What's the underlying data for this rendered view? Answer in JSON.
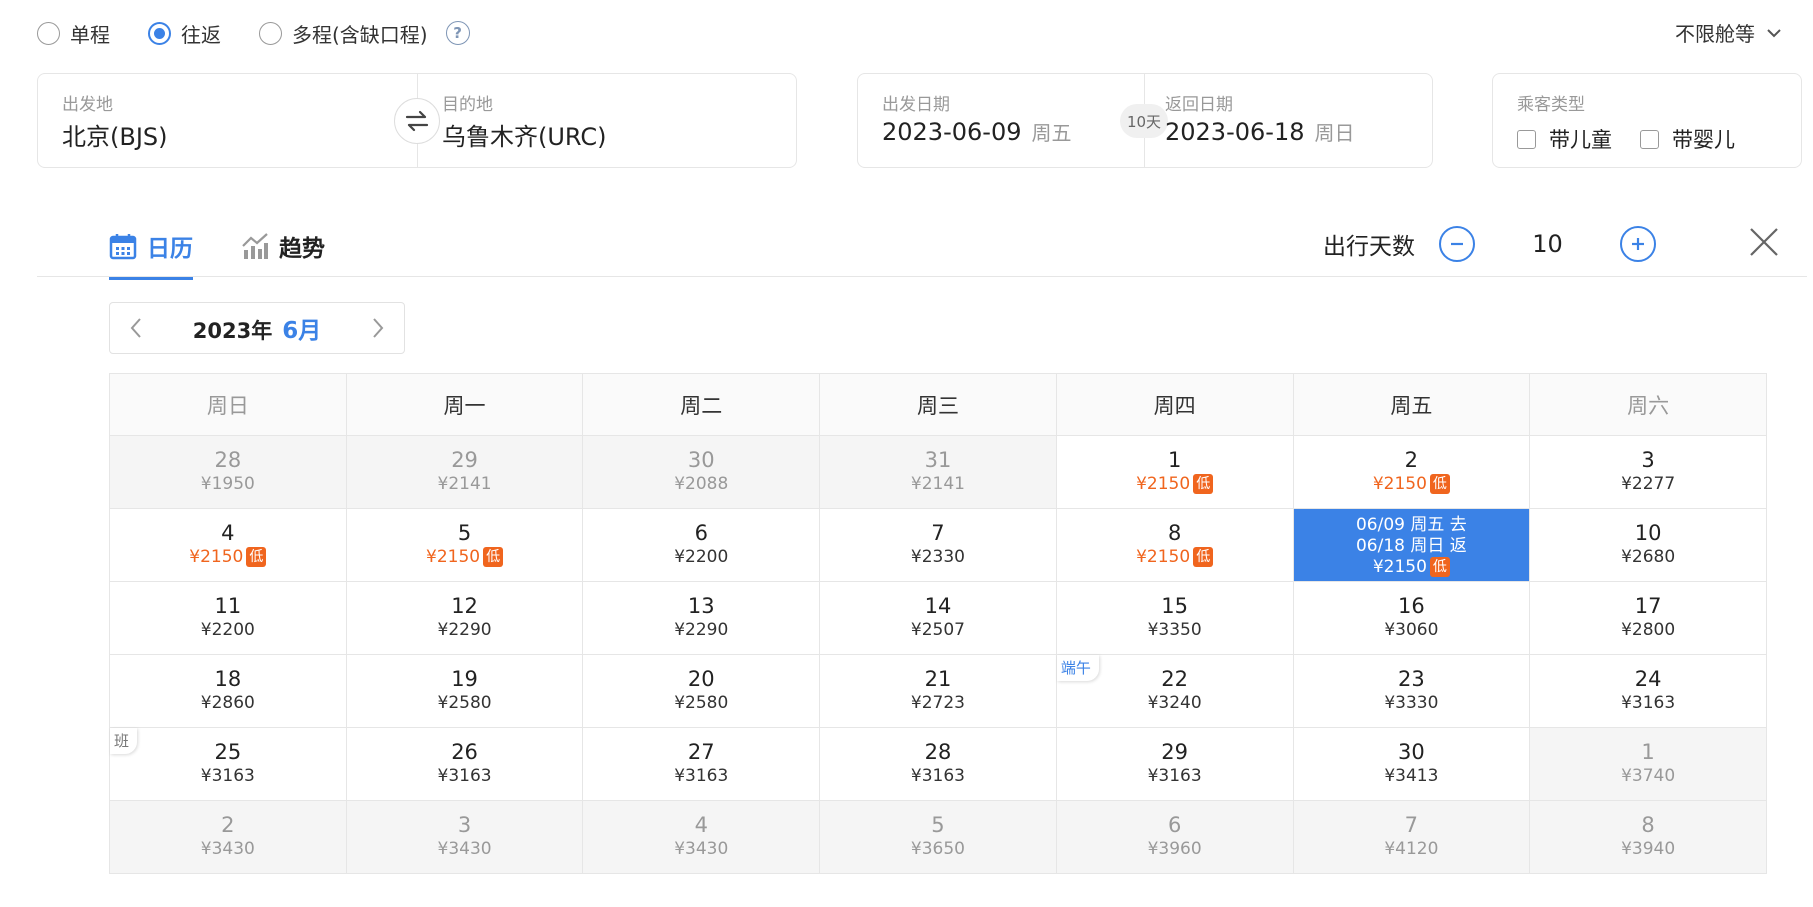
{
  "trip_type": {
    "options": [
      {
        "label": "单程",
        "selected": false
      },
      {
        "label": "往返",
        "selected": true
      },
      {
        "label": "多程(含缺口程)",
        "selected": false
      }
    ],
    "help": "?"
  },
  "cabin": {
    "label": "不限舱等"
  },
  "route": {
    "from_label": "出发地",
    "from_value": "北京(BJS)",
    "to_label": "目的地",
    "to_value": "乌鲁木齐(URC)"
  },
  "dates": {
    "depart_label": "出发日期",
    "depart_value": "2023-06-09",
    "depart_weekday": "周五",
    "return_label": "返回日期",
    "return_value": "2023-06-18",
    "return_weekday": "周日",
    "days_pill": "10天"
  },
  "passengers": {
    "label": "乘客类型",
    "child": "带儿童",
    "infant": "带婴儿"
  },
  "tabs": [
    {
      "label": "日历",
      "active": true
    },
    {
      "label": "趋势",
      "active": false
    }
  ],
  "duration": {
    "label": "出行天数",
    "value": "10"
  },
  "month_nav": {
    "year": "2023年",
    "month": "6月"
  },
  "colors": {
    "accent": "#3b82e6",
    "low": "#f0651e"
  },
  "calendar": {
    "weekdays": [
      "周日",
      "周一",
      "周二",
      "周三",
      "周四",
      "周五",
      "周六"
    ],
    "low_tag": "低",
    "rows": [
      [
        {
          "d": "28",
          "p": "¥1950",
          "grey": true
        },
        {
          "d": "29",
          "p": "¥2141",
          "grey": true
        },
        {
          "d": "30",
          "p": "¥2088",
          "grey": true
        },
        {
          "d": "31",
          "p": "¥2141",
          "grey": true
        },
        {
          "d": "1",
          "p": "¥2150",
          "low": true
        },
        {
          "d": "2",
          "p": "¥2150",
          "low": true
        },
        {
          "d": "3",
          "p": "¥2277"
        }
      ],
      [
        {
          "d": "4",
          "p": "¥2150",
          "low": true
        },
        {
          "d": "5",
          "p": "¥2150",
          "low": true
        },
        {
          "d": "6",
          "p": "¥2200"
        },
        {
          "d": "7",
          "p": "¥2330"
        },
        {
          "d": "8",
          "p": "¥2150",
          "low": true
        },
        {
          "selected": true,
          "l1": "06/09 周五 去",
          "l2": "06/18 周日 返",
          "p": "¥2150",
          "low": true
        },
        {
          "d": "10",
          "p": "¥2680"
        }
      ],
      [
        {
          "d": "11",
          "p": "¥2200"
        },
        {
          "d": "12",
          "p": "¥2290"
        },
        {
          "d": "13",
          "p": "¥2290"
        },
        {
          "d": "14",
          "p": "¥2507"
        },
        {
          "d": "15",
          "p": "¥3350"
        },
        {
          "d": "16",
          "p": "¥3060"
        },
        {
          "d": "17",
          "p": "¥2800"
        }
      ],
      [
        {
          "d": "18",
          "p": "¥2860"
        },
        {
          "d": "19",
          "p": "¥2580"
        },
        {
          "d": "20",
          "p": "¥2580"
        },
        {
          "d": "21",
          "p": "¥2723"
        },
        {
          "d": "22",
          "p": "¥3240",
          "tag": "端午",
          "tag_type": "holiday"
        },
        {
          "d": "23",
          "p": "¥3330"
        },
        {
          "d": "24",
          "p": "¥3163"
        }
      ],
      [
        {
          "d": "25",
          "p": "¥3163",
          "tag": "班",
          "tag_type": "work"
        },
        {
          "d": "26",
          "p": "¥3163"
        },
        {
          "d": "27",
          "p": "¥3163"
        },
        {
          "d": "28",
          "p": "¥3163"
        },
        {
          "d": "29",
          "p": "¥3163"
        },
        {
          "d": "30",
          "p": "¥3413"
        },
        {
          "d": "1",
          "p": "¥3740",
          "grey": true
        }
      ],
      [
        {
          "d": "2",
          "p": "¥3430",
          "grey": true
        },
        {
          "d": "3",
          "p": "¥3430",
          "grey": true
        },
        {
          "d": "4",
          "p": "¥3430",
          "grey": true
        },
        {
          "d": "5",
          "p": "¥3650",
          "grey": true
        },
        {
          "d": "6",
          "p": "¥3960",
          "grey": true
        },
        {
          "d": "7",
          "p": "¥4120",
          "grey": true
        },
        {
          "d": "8",
          "p": "¥3940",
          "grey": true
        }
      ]
    ]
  }
}
